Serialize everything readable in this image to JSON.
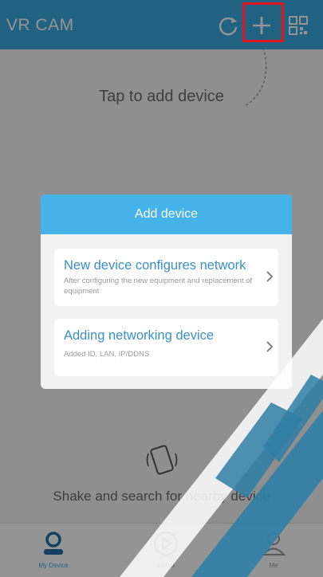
{
  "header": {
    "app_title": "VR CAM",
    "icons": [
      "refresh-icon",
      "plus-icon",
      "qr-scan-icon"
    ]
  },
  "main": {
    "hint_text": "Tap to add device",
    "shake_text": "Shake and search for nearby device"
  },
  "dialog": {
    "title": "Add device",
    "options": [
      {
        "title": "New device configures network",
        "subtitle": "After configuring the new equipment and replacement of equipment"
      },
      {
        "title": "Adding networking device",
        "subtitle": "Added ID, LAN, IP/DDNS"
      }
    ]
  },
  "bottom_nav": {
    "items": [
      {
        "label": "My Device",
        "icon": "user-icon"
      },
      {
        "label": "Demo",
        "icon": "play-icon"
      },
      {
        "label": "Me",
        "icon": "person-icon"
      }
    ]
  },
  "colors": {
    "header": "#3aa9e0",
    "dialog_header": "#45b3e7",
    "option_title": "#3a8fc8",
    "highlight_box": "#e0141b"
  }
}
